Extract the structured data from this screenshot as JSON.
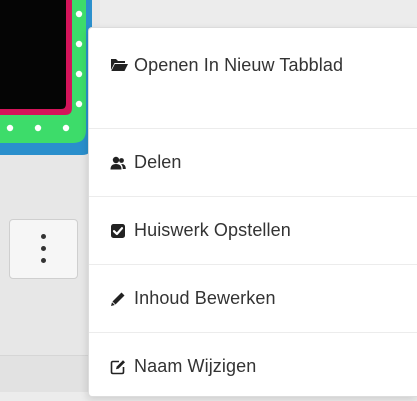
{
  "menu": {
    "open_new_tab_label": "Openen In Nieuw Tabblad",
    "share_label": "Delen",
    "assign_homework_label": "Huiswerk Opstellen",
    "edit_content_label": "Inhoud Bewerken",
    "rename_label": "Naam Wijzigen",
    "icons": {
      "open_new_tab": "folder-open-icon",
      "share": "users-icon",
      "assign_homework": "checkbox-icon",
      "edit_content": "pencil-icon",
      "rename": "edit-square-icon"
    }
  },
  "card": {
    "more_button_icon": "kebab-menu-icon"
  },
  "colors": {
    "thumbnail_green": "#3ddc6a",
    "thumbnail_pink": "#d4145a",
    "thumbnail_blue": "#1e7fc0",
    "menu_text": "#333333"
  }
}
